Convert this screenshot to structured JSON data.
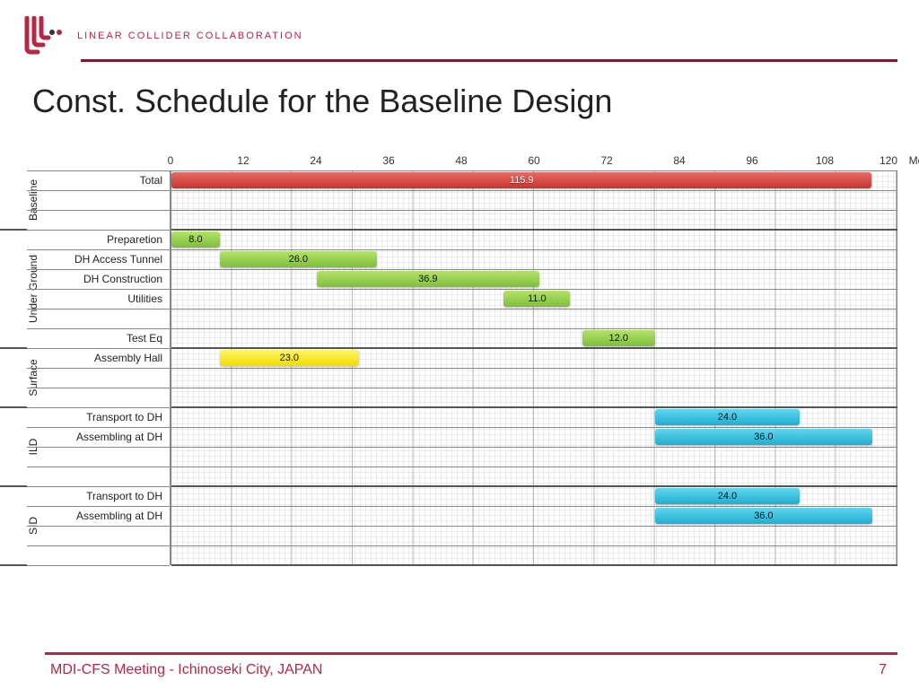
{
  "header": {
    "brand": "LINEAR COLLIDER COLLABORATION"
  },
  "title": "Const. Schedule for the Baseline Design",
  "footer": {
    "left": "MDI-CFS Meeting - Ichinoseki City, JAPAN",
    "page": "7"
  },
  "chart_data": {
    "type": "bar",
    "title": "Const. Schedule for the Baseline Design",
    "xlabel": "Months",
    "ylabel": "",
    "xlim": [
      0,
      120
    ],
    "ticks": [
      0,
      12,
      24,
      36,
      48,
      60,
      72,
      84,
      96,
      108,
      120
    ],
    "rows_per_group_slot": 22,
    "groups": [
      {
        "name": "Baseline",
        "rows": 3,
        "tasks": [
          {
            "row": 0,
            "label": "Total",
            "start": 0,
            "duration": 115.9,
            "color": "red"
          }
        ]
      },
      {
        "name": "Under Ground",
        "rows": 6,
        "tasks": [
          {
            "row": 0,
            "label": "Preparetion",
            "start": 0,
            "duration": 8.0,
            "color": "green"
          },
          {
            "row": 1,
            "label": "DH Access Tunnel",
            "start": 8.0,
            "duration": 26.0,
            "color": "green"
          },
          {
            "row": 2,
            "label": "DH Construction",
            "start": 24.0,
            "duration": 36.9,
            "color": "green"
          },
          {
            "row": 3,
            "label": "Utilities",
            "start": 55.0,
            "duration": 11.0,
            "label_inside": "11.0",
            "color": "green"
          },
          {
            "row": 5,
            "label": "Test Eq",
            "start": 68.0,
            "duration": 12.0,
            "color": "green"
          }
        ]
      },
      {
        "name": "Surface",
        "rows": 3,
        "tasks": [
          {
            "row": 0,
            "label": "Assembly Hall",
            "start": 8.0,
            "duration": 23.0,
            "color": "yellow"
          }
        ]
      },
      {
        "name": "ILD",
        "rows": 4,
        "tasks": [
          {
            "row": 0,
            "label": "Transport to DH",
            "start": 80.0,
            "duration": 24.0,
            "color": "blue"
          },
          {
            "row": 1,
            "label": "Assembling at DH",
            "start": 80.0,
            "duration": 36.0,
            "color": "blue"
          }
        ]
      },
      {
        "name": "SID",
        "rows": 4,
        "tasks": [
          {
            "row": 0,
            "label": "Transport to DH",
            "start": 80.0,
            "duration": 24.0,
            "color": "blue"
          },
          {
            "row": 1,
            "label": "Assembling at DH",
            "start": 80.0,
            "duration": 36.0,
            "color": "blue"
          }
        ]
      }
    ]
  }
}
